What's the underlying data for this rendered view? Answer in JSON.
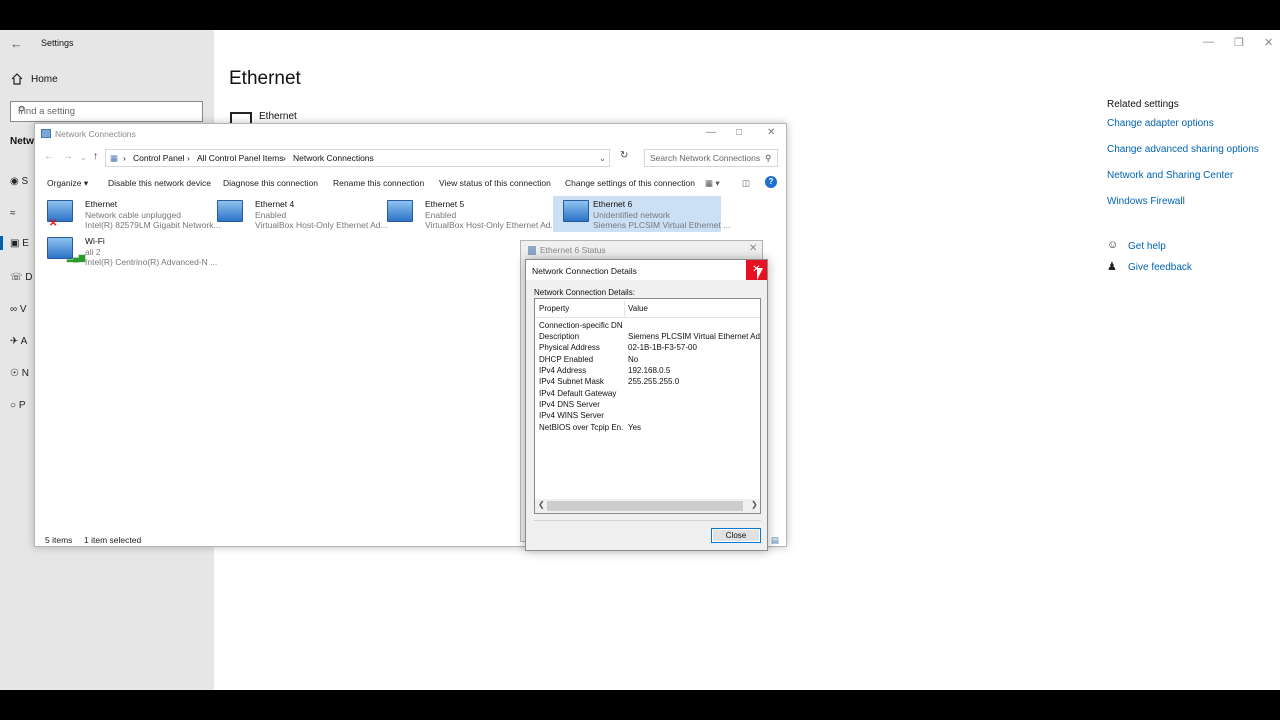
{
  "settings": {
    "window_title": "Settings",
    "home_label": "Home",
    "search_placeholder": "Find a setting",
    "section_label": "Netw",
    "nav_letters": [
      "S",
      "",
      "E",
      "D",
      "V",
      "A",
      "N",
      "P"
    ],
    "page_title": "Ethernet",
    "ethernet_label": "Ethernet",
    "related_title": "Related settings",
    "related_links": [
      "Change adapter options",
      "Change advanced sharing options",
      "Network and Sharing Center",
      "Windows Firewall"
    ],
    "help_links": [
      "Get help",
      "Give feedback"
    ]
  },
  "network_connections": {
    "title": "Network Connections",
    "breadcrumb": [
      "Control Panel",
      "All Control Panel Items",
      "Network Connections"
    ],
    "search_placeholder": "Search Network Connections",
    "toolbar": [
      "Organize ▾",
      "Disable this network device",
      "Diagnose this connection",
      "Rename this connection",
      "View status of this connection",
      "Change settings of this connection"
    ],
    "items": [
      {
        "name": "Ethernet",
        "status": "Network cable unplugged",
        "device": "Intel(R) 82579LM Gigabit Network..."
      },
      {
        "name": "Ethernet 4",
        "status": "Enabled",
        "device": "VirtualBox Host-Only Ethernet Ad..."
      },
      {
        "name": "Ethernet 5",
        "status": "Enabled",
        "device": "VirtualBox Host-Only Ethernet Ad..."
      },
      {
        "name": "Ethernet 6",
        "status": "Unidentified network",
        "device": "Siemens PLCSIM Virtual Ethernet ..."
      },
      {
        "name": "Wi-Fi",
        "status": "ali 2",
        "device": "Intel(R) Centrino(R) Advanced-N ..."
      }
    ],
    "status_count": "5 items",
    "status_selected": "1 item selected"
  },
  "ethernet_status": {
    "title": "Ethernet 6 Status"
  },
  "details": {
    "title": "Network Connection Details",
    "label": "Network Connection Details:",
    "col_property": "Property",
    "col_value": "Value",
    "rows": [
      {
        "property": "Connection-specific DN...",
        "value": ""
      },
      {
        "property": "Description",
        "value": "Siemens PLCSIM Virtual Ethernet Adapter"
      },
      {
        "property": "Physical Address",
        "value": "02-1B-1B-F3-57-00"
      },
      {
        "property": "DHCP Enabled",
        "value": "No"
      },
      {
        "property": "IPv4 Address",
        "value": "192.168.0.5"
      },
      {
        "property": "IPv4 Subnet Mask",
        "value": "255.255.255.0"
      },
      {
        "property": "IPv4 Default Gateway",
        "value": ""
      },
      {
        "property": "IPv4 DNS Server",
        "value": ""
      },
      {
        "property": "IPv4 WINS Server",
        "value": ""
      },
      {
        "property": "NetBIOS over Tcpip En...",
        "value": "Yes"
      }
    ],
    "close_label": "Close"
  }
}
